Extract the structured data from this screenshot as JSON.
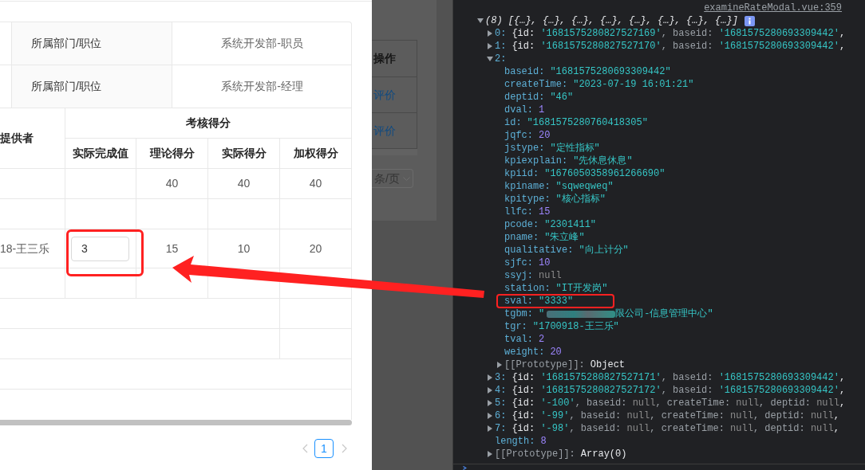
{
  "modal": {
    "info_rows": [
      {
        "label": "所属部门/职位",
        "value": "系统开发部-职员"
      },
      {
        "label": "所属部门/职位",
        "value": "系统开发部-经理"
      }
    ],
    "score_table": {
      "provider_header": "提供者",
      "group_header": "考核得分",
      "columns": [
        "实际完成值",
        "理论得分",
        "实际得分",
        "加权得分"
      ],
      "rows": [
        {
          "kind": "scores",
          "scores": [
            "40",
            "40",
            "40"
          ]
        },
        {
          "kind": "blank"
        },
        {
          "kind": "scores",
          "provider": "18-王三乐",
          "completion_input": "3",
          "scores": [
            "15",
            "10",
            "20"
          ]
        },
        {
          "kind": "blank"
        },
        {
          "kind": "merged"
        },
        {
          "kind": "merged"
        },
        {
          "kind": "full"
        }
      ]
    },
    "pagination": {
      "prev": {
        "disabled": true
      },
      "pages": [
        {
          "label": "1",
          "selected": true
        }
      ],
      "next": {
        "disabled": true
      }
    }
  },
  "background_page": {
    "column_header": "操作",
    "row_links": [
      "评价",
      "评价"
    ],
    "page_size_select": "条/页"
  },
  "console": {
    "source_link": "examineRateModal.vue:359",
    "tree": {
      "kind": "array",
      "summary": "(8) [{…}, {…}, {…}, {…}, {…}, {…}, {…}, {…}]",
      "info_badge": true,
      "expanded": true,
      "children": [
        {
          "kind": "object",
          "key": "0:",
          "expanded": false,
          "preview": [
            {
              "kind": "plain",
              "text": "{id: "
            },
            {
              "kind": "string",
              "text": "'1681575280827527169'"
            },
            {
              "kind": "dim",
              "text": ", baseid: "
            },
            {
              "kind": "string",
              "text": "'1681575280693309442'"
            },
            {
              "kind": "plain",
              "text": ","
            }
          ]
        },
        {
          "kind": "object",
          "key": "1:",
          "expanded": false,
          "preview": [
            {
              "kind": "plain",
              "text": "{id: "
            },
            {
              "kind": "string",
              "text": "'1681575280827527170'"
            },
            {
              "kind": "dim",
              "text": ", baseid: "
            },
            {
              "kind": "string",
              "text": "'1681575280693309442'"
            },
            {
              "kind": "plain",
              "text": ","
            }
          ]
        },
        {
          "kind": "object",
          "key": "2:",
          "expanded": true,
          "children": [
            {
              "kind": "string",
              "key": "baseid:",
              "value": "\"1681575280693309442\""
            },
            {
              "kind": "string",
              "key": "createTime:",
              "value": "\"2023-07-19 16:01:21\""
            },
            {
              "kind": "string",
              "key": "deptid:",
              "value": "\"46\""
            },
            {
              "kind": "number",
              "key": "dval:",
              "value": "1"
            },
            {
              "kind": "string",
              "key": "id:",
              "value": "\"1681575280760418305\""
            },
            {
              "kind": "number",
              "key": "jqfc:",
              "value": "20"
            },
            {
              "kind": "string",
              "key": "jstype:",
              "value": "\"定性指标\""
            },
            {
              "kind": "string",
              "key": "kpiexplain:",
              "value": "\"先休息休息\""
            },
            {
              "kind": "string",
              "key": "kpiid:",
              "value": "\"1676050358961266690\""
            },
            {
              "kind": "string",
              "key": "kpiname:",
              "value": "\"sqweqweq\""
            },
            {
              "kind": "string",
              "key": "kpitype:",
              "value": "\"核心指标\""
            },
            {
              "kind": "number",
              "key": "llfc:",
              "value": "15"
            },
            {
              "kind": "string",
              "key": "pcode:",
              "value": "\"2301411\""
            },
            {
              "kind": "string",
              "key": "pname:",
              "value": "\"朱立峰\""
            },
            {
              "kind": "string",
              "key": "qualitative:",
              "value": "\"向上计分\""
            },
            {
              "kind": "number",
              "key": "sjfc:",
              "value": "10"
            },
            {
              "kind": "null",
              "key": "ssyj:",
              "value": "null"
            },
            {
              "kind": "string",
              "key": "station:",
              "value": "\"IT开发岗\""
            },
            {
              "kind": "string",
              "key": "sval:",
              "value": "\"3333\""
            },
            {
              "kind": "string",
              "key": "tgbm:",
              "redacted": true,
              "value_prefix": "\"",
              "value": "限公司-信息管理中心\""
            },
            {
              "kind": "string",
              "key": "tgr:",
              "value": "\"1700918-王三乐\""
            },
            {
              "kind": "number",
              "key": "tval:",
              "value": "2"
            },
            {
              "kind": "number",
              "key": "weight:",
              "value": "20"
            },
            {
              "kind": "prototype",
              "key": "[[Prototype]]:",
              "value": "Object",
              "expanded": false
            }
          ]
        },
        {
          "kind": "object",
          "key": "3:",
          "expanded": false,
          "preview": [
            {
              "kind": "plain",
              "text": "{id: "
            },
            {
              "kind": "string",
              "text": "'1681575280827527171'"
            },
            {
              "kind": "dim",
              "text": ", baseid: "
            },
            {
              "kind": "string",
              "text": "'1681575280693309442'"
            },
            {
              "kind": "plain",
              "text": ","
            }
          ]
        },
        {
          "kind": "object",
          "key": "4:",
          "expanded": false,
          "preview": [
            {
              "kind": "plain",
              "text": "{id: "
            },
            {
              "kind": "string",
              "text": "'1681575280827527172'"
            },
            {
              "kind": "dim",
              "text": ", baseid: "
            },
            {
              "kind": "string",
              "text": "'1681575280693309442'"
            },
            {
              "kind": "plain",
              "text": ","
            }
          ]
        },
        {
          "kind": "object",
          "key": "5:",
          "expanded": false,
          "preview": [
            {
              "kind": "plain",
              "text": "{id: "
            },
            {
              "kind": "string",
              "text": "'-100'"
            },
            {
              "kind": "dim",
              "text": ", baseid: "
            },
            {
              "kind": "null",
              "text": "null"
            },
            {
              "kind": "dim",
              "text": ", createTime: "
            },
            {
              "kind": "null",
              "text": "null"
            },
            {
              "kind": "dim",
              "text": ", deptid: "
            },
            {
              "kind": "null",
              "text": "null"
            },
            {
              "kind": "plain",
              "text": ","
            }
          ]
        },
        {
          "kind": "object",
          "key": "6:",
          "expanded": false,
          "preview": [
            {
              "kind": "plain",
              "text": "{id: "
            },
            {
              "kind": "string",
              "text": "'-99'"
            },
            {
              "kind": "dim",
              "text": ", baseid: "
            },
            {
              "kind": "null",
              "text": "null"
            },
            {
              "kind": "dim",
              "text": ", createTime: "
            },
            {
              "kind": "null",
              "text": "null"
            },
            {
              "kind": "dim",
              "text": ", deptid: "
            },
            {
              "kind": "null",
              "text": "null"
            },
            {
              "kind": "plain",
              "text": ","
            }
          ]
        },
        {
          "kind": "object",
          "key": "7:",
          "expanded": false,
          "preview": [
            {
              "kind": "plain",
              "text": "{id: "
            },
            {
              "kind": "string",
              "text": "'-98'"
            },
            {
              "kind": "dim",
              "text": ", baseid: "
            },
            {
              "kind": "null",
              "text": "null"
            },
            {
              "kind": "dim",
              "text": ", createTime: "
            },
            {
              "kind": "null",
              "text": "null"
            },
            {
              "kind": "dim",
              "text": ", deptid: "
            },
            {
              "kind": "null",
              "text": "null"
            },
            {
              "kind": "plain",
              "text": ","
            }
          ]
        },
        {
          "kind": "number",
          "key": "length:",
          "value": "8"
        },
        {
          "kind": "prototype",
          "key": "[[Prototype]]:",
          "value": "Array(0)",
          "expanded": false
        }
      ]
    }
  }
}
